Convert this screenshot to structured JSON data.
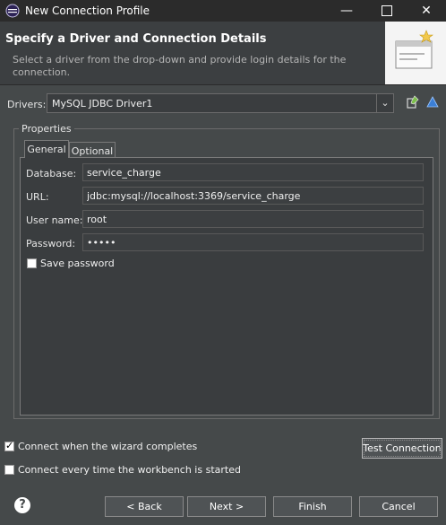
{
  "window": {
    "title": "New Connection Profile"
  },
  "header": {
    "title": "Specify a Driver and Connection Details",
    "description": "Select a driver from the drop-down and provide login details for the connection."
  },
  "drivers": {
    "label": "Drivers:",
    "selected": "MySQL JDBC Driver1"
  },
  "properties": {
    "group_label": "Properties",
    "tabs": [
      {
        "label": "General"
      },
      {
        "label": "Optional"
      }
    ],
    "fields": {
      "database": {
        "label": "Database:",
        "value": "service_charge"
      },
      "url": {
        "label": "URL:",
        "value": "jdbc:mysql://localhost:3369/service_charge"
      },
      "user_name": {
        "label": "User name:",
        "value": "root"
      },
      "password": {
        "label": "Password:",
        "value": "•••••"
      }
    },
    "save_password": {
      "label": "Save password",
      "checked": false
    }
  },
  "options": {
    "connect_on_complete": {
      "label": "Connect when the wizard completes",
      "checked": true
    },
    "connect_every_time": {
      "label": "Connect every time the workbench is started",
      "checked": false
    }
  },
  "buttons": {
    "test_connection": "Test Connection",
    "back": "< Back",
    "next": "Next >",
    "finish": "Finish",
    "cancel": "Cancel"
  },
  "icons": {
    "app": "eclipse-icon",
    "edit_driver": "edit-driver-icon",
    "new_driver": "new-driver-icon",
    "help": "help-icon"
  },
  "colors": {
    "background": "#45494a",
    "titlebar": "#2b2b2b",
    "accent": "#1e88e5"
  }
}
